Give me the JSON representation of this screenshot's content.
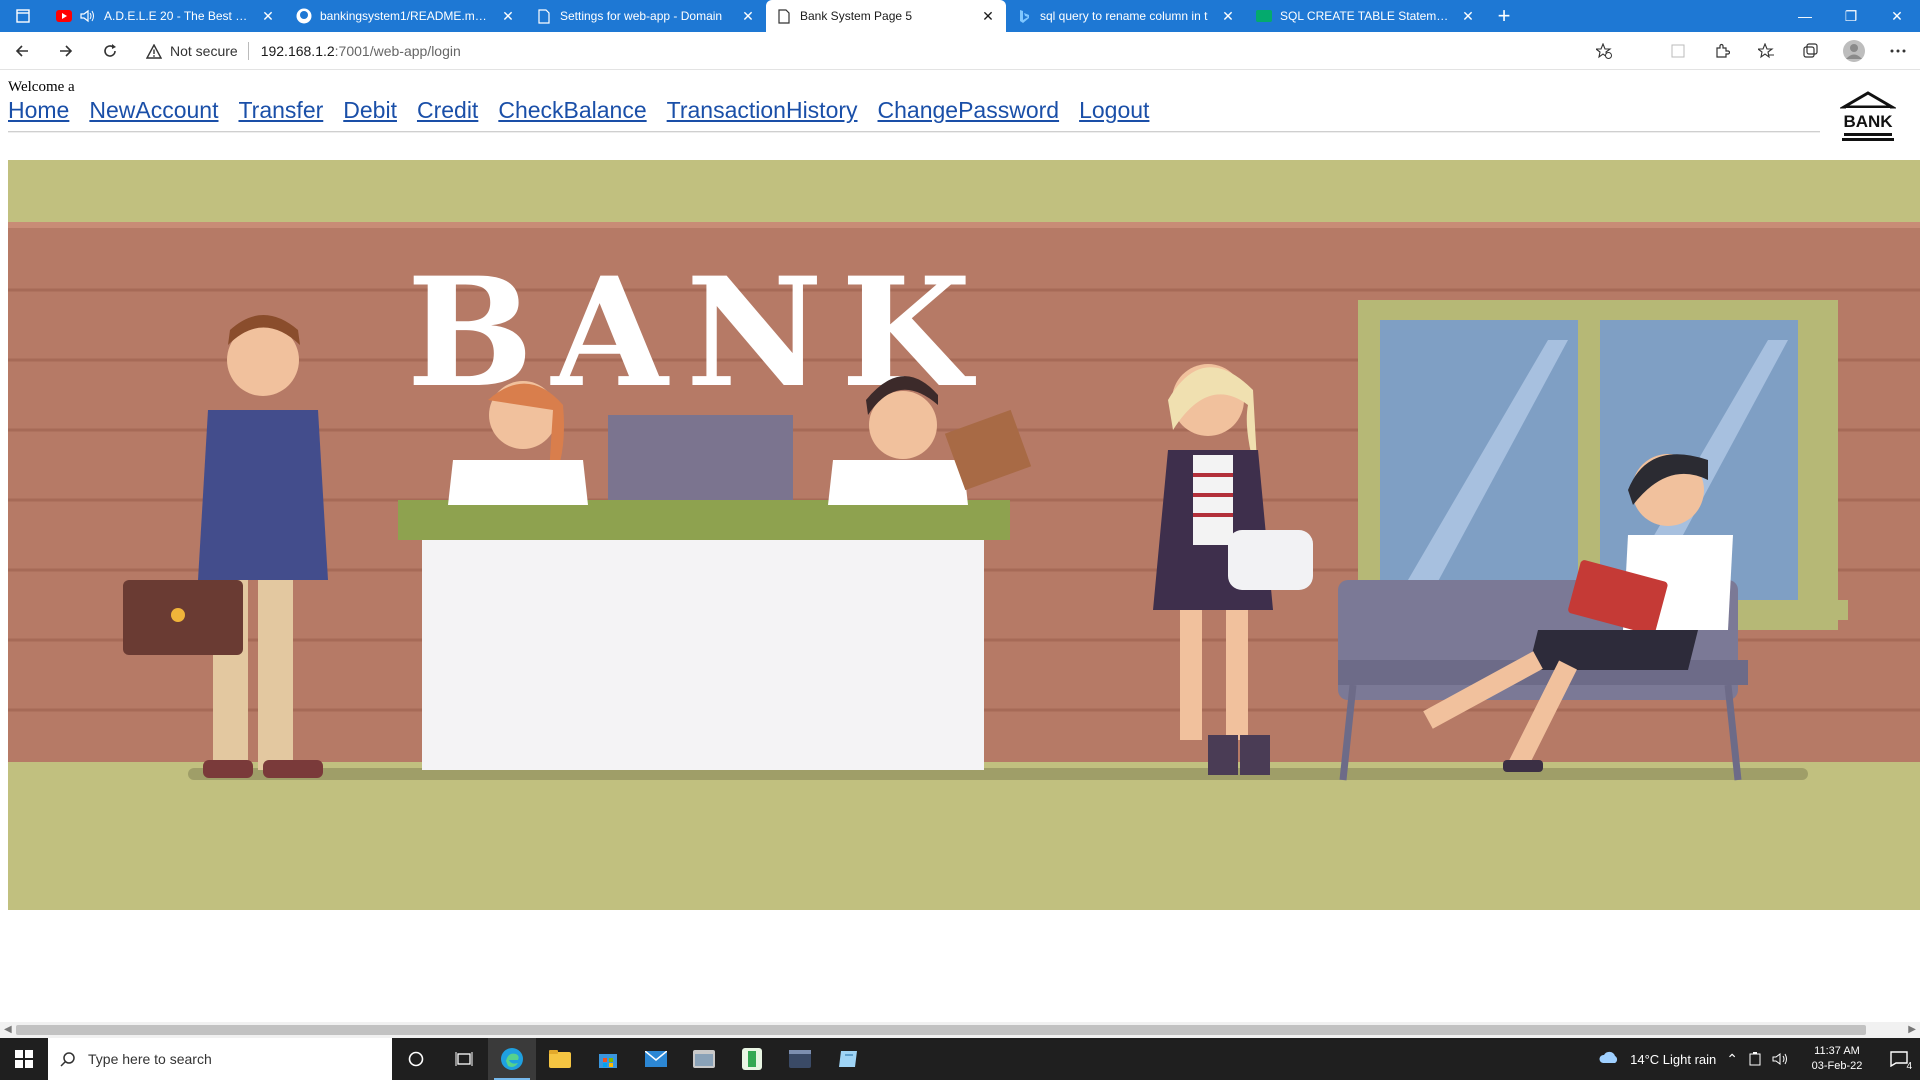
{
  "browser": {
    "tabs": [
      {
        "title": "A.D.E.L.E 20 - The Best of A",
        "icon": "youtube-icon"
      },
      {
        "title": "bankingsystem1/README.md at",
        "icon": "github-icon"
      },
      {
        "title": "Settings for web-app - Domain",
        "icon": "page-icon"
      },
      {
        "title": "Bank System Page 5",
        "icon": "page-icon"
      },
      {
        "title": "sql query to rename column in t",
        "icon": "bing-icon"
      },
      {
        "title": "SQL CREATE TABLE Statement",
        "icon": "w3schools-icon"
      }
    ],
    "active_tab_index": 3,
    "address": {
      "security_label": "Not secure",
      "host": "192.168.1.2",
      "path": ":7001/web-app/login"
    }
  },
  "page": {
    "welcome": "Welcome a",
    "nav": [
      {
        "label": "Home"
      },
      {
        "label": "NewAccount"
      },
      {
        "label": "Transfer"
      },
      {
        "label": "Debit"
      },
      {
        "label": "Credit"
      },
      {
        "label": "CheckBalance"
      },
      {
        "label": "TransactionHistory"
      },
      {
        "label": "ChangePassword"
      },
      {
        "label": "Logout"
      }
    ],
    "logo_text": "BANK",
    "hero_sign_text": "BANK"
  },
  "taskbar": {
    "search_placeholder": "Type here to search",
    "weather": "14°C  Light rain",
    "time": "11:37 AM",
    "date": "03-Feb-22",
    "notification_count": "4"
  },
  "colors": {
    "tabstrip": "#1e78d4",
    "link": "#1a4fa8",
    "hero_wall": "#b67a66",
    "hero_floor": "#c1c07f"
  }
}
